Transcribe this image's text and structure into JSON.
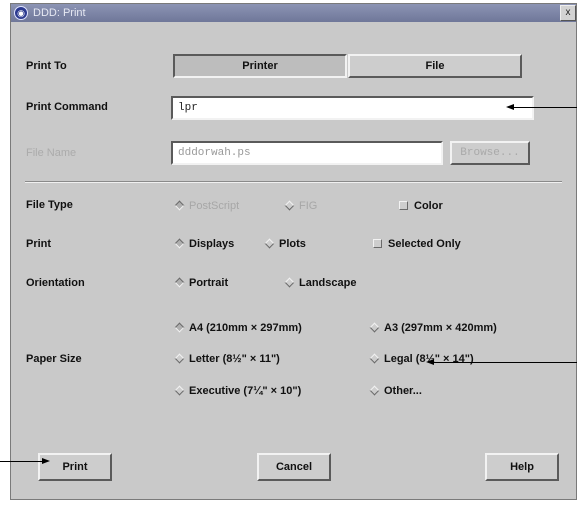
{
  "window": {
    "title": "DDD: Print",
    "close_glyph": "x"
  },
  "print_to": {
    "label": "Print To",
    "printer_label": "Printer",
    "file_label": "File"
  },
  "print_command": {
    "label": "Print Command",
    "value": "lpr"
  },
  "file_name": {
    "label": "File Name",
    "value": "dddorwah.ps",
    "browse_label": "Browse..."
  },
  "file_type": {
    "label": "File Type",
    "postscript": "PostScript",
    "fig": "FIG",
    "color": "Color"
  },
  "print_what": {
    "label": "Print",
    "displays": "Displays",
    "plots": "Plots",
    "selected_only": "Selected Only"
  },
  "orientation": {
    "label": "Orientation",
    "portrait": "Portrait",
    "landscape": "Landscape"
  },
  "paper_size": {
    "label": "Paper Size",
    "a4": "A4 (210mm × 297mm)",
    "a3": "A3 (297mm × 420mm)",
    "letter": "Letter (8½\" × 11\")",
    "legal": "Legal (8½\" × 14\")",
    "executive": "Executive (7¼\" × 10\")",
    "other": "Other..."
  },
  "buttons": {
    "print": "Print",
    "cancel": "Cancel",
    "help": "Help"
  },
  "colors": {
    "dialog_bg": "#c9c9c9",
    "titlebar": "#7a82a4",
    "disabled_text": "#a7a7a7"
  }
}
